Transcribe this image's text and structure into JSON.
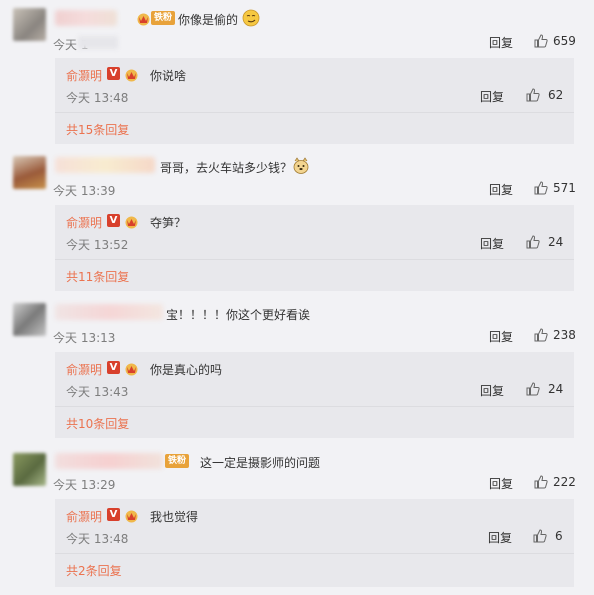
{
  "threads": [
    {
      "comment_text": "你像是偷的",
      "time": "今天 1",
      "reply_label": "回复",
      "likes": "659",
      "reply": {
        "name": "俞灏明",
        "text": "你说啥",
        "time": "今天 13:48",
        "reply_label": "回复",
        "likes": "62",
        "more": "共15条回复"
      }
    },
    {
      "comment_text": "哥哥，去火车站多少钱？",
      "time": "今天 13:39",
      "reply_label": "回复",
      "likes": "571",
      "reply": {
        "name": "俞灏明",
        "text": "夺笋？",
        "time": "今天 13:52",
        "reply_label": "回复",
        "likes": "24",
        "more": "共11条回复"
      }
    },
    {
      "comment_text": "宝！！！！你这个更好看诶",
      "time": "今天 13:13",
      "reply_label": "回复",
      "likes": "238",
      "reply": {
        "name": "俞灏明",
        "text": "你是真心的吗",
        "time": "今天 13:43",
        "reply_label": "回复",
        "likes": "24",
        "more": "共10条回复"
      }
    },
    {
      "comment_text": "这一定是摄影师的问题",
      "time": "今天 13:29",
      "reply_label": "回复",
      "likes": "222",
      "reply": {
        "name": "俞灏明",
        "text": "我也觉得",
        "time": "今天 13:48",
        "reply_label": "回复",
        "likes": "6",
        "more": "共2条回复"
      }
    }
  ],
  "badges": {
    "fan": "铁粉",
    "verified": "V"
  },
  "colors": {
    "background": "#f2f2f5",
    "reply_background": "#e8e8ec",
    "username_orange": "#eb7350",
    "verified_red": "#d8402c",
    "fan_badge": "#e8a23a",
    "muted_text": "#7d7d7d"
  },
  "icons": [
    "thumbs-up-icon",
    "crown-fan-icon",
    "verified-v-icon",
    "smirk-emoji-icon",
    "doge-emoji-icon"
  ]
}
